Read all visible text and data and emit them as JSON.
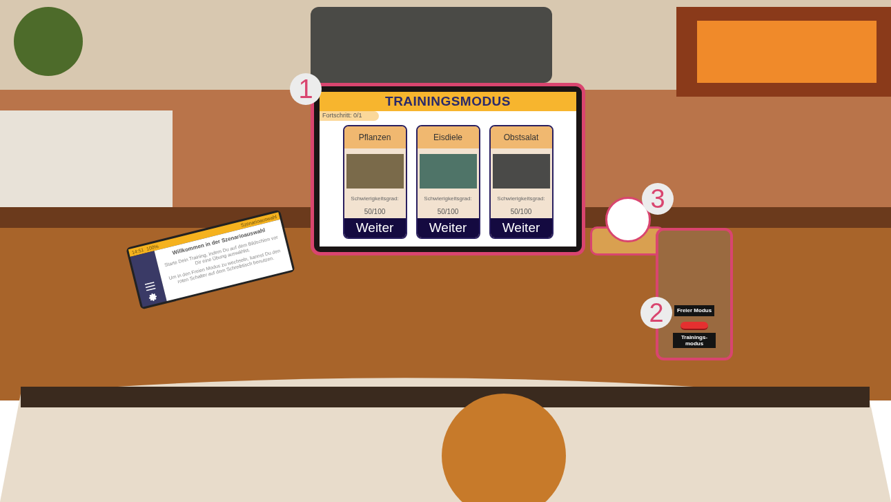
{
  "tablet": {
    "status_time": "14:51",
    "status_battery": "100%",
    "status_title": "Szenarioauswahl",
    "heading": "Willkommen in der Szenarioauswahl",
    "paragraphs": [
      "Starte Dein Training, indem Du auf dem Bildschirm vor Dir eine Übung auswählst.",
      "Um in den Freien Modus zu wechseln, kannst Du den roten Schalter auf dem Schreibtisch benutzen."
    ]
  },
  "screen": {
    "marker": "1",
    "title": "TRAININGSMODUS",
    "progress": "Fortschritt: 0/1",
    "cards": [
      {
        "title": "Pflanzen",
        "difficulty_label": "Schwierigkeitsgrad:",
        "difficulty": "50/100",
        "button": "Weiter"
      },
      {
        "title": "Eisdiele",
        "difficulty_label": "Schwierigkeitsgrad:",
        "difficulty": "50/100",
        "button": "Weiter"
      },
      {
        "title": "Obstsalat",
        "difficulty_label": "Schwierigkeitsgrad:",
        "difficulty": "50/100",
        "button": "Weiter"
      }
    ]
  },
  "switch_box": {
    "marker": "2",
    "top_label": "Freier Modus",
    "bottom_label": "Trainings-modus",
    "on": false
  },
  "ball": {
    "marker": "3"
  }
}
